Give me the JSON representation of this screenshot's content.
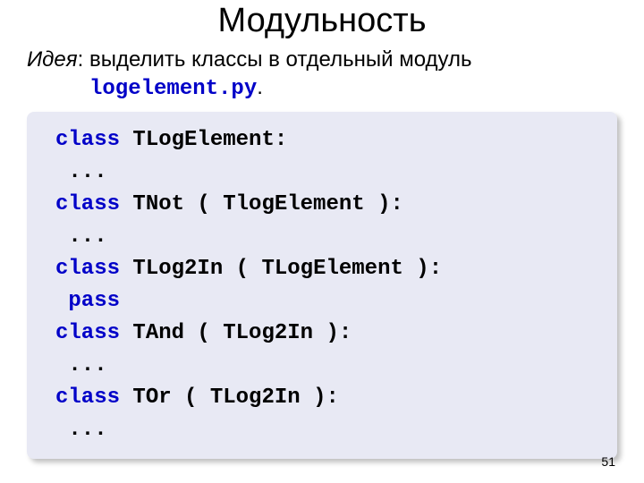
{
  "title": "Модульность",
  "idea": {
    "label": "Идея",
    "text": "выделить классы в отдельный модуль",
    "filename": "logelement.py"
  },
  "code": {
    "kw_class": "class",
    "kw_pass": "pass",
    "c1_name": "TLogElement:",
    "ell": "...",
    "c2_name": "TNot",
    "c2_rest": " ( TlogElement ):",
    "c3_name": "TLog2In",
    "c3_rest": " ( TLogElement ):",
    "c4_name": "TAnd",
    "c4_rest": " ( TLog2In ):",
    "c5_name": "TOr",
    "c5_rest": " ( TLog2In ):"
  },
  "page": "51"
}
